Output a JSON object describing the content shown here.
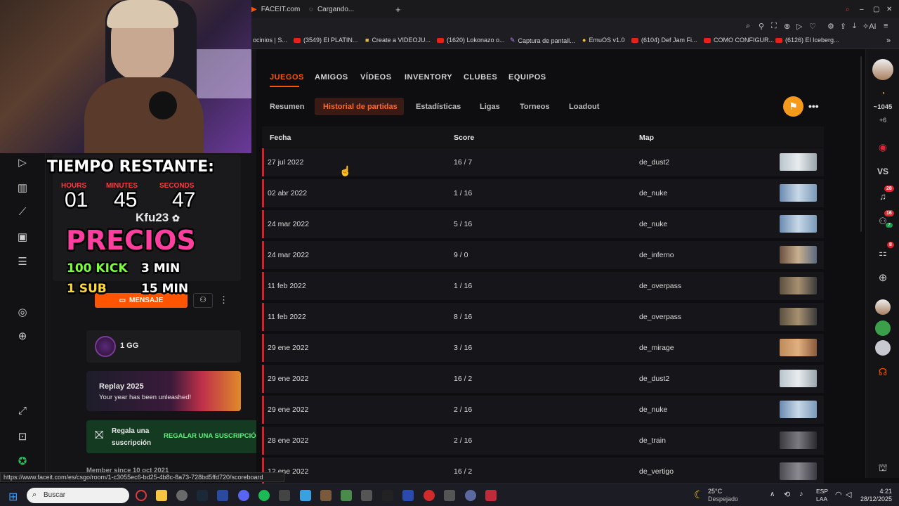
{
  "browser": {
    "tabs": [
      {
        "label": "FACEIT.com"
      },
      {
        "label": "Cargando..."
      }
    ],
    "new_tab": "+",
    "bookmarks": [
      {
        "label": "ocinios | S..."
      },
      {
        "label": "(3549) El PLATIN..."
      },
      {
        "label": "Create a VIDEOJU..."
      },
      {
        "label": "(1620) Lokonazo o..."
      },
      {
        "label": "Captura de pantall..."
      },
      {
        "label": "EmuOS v1.0"
      },
      {
        "label": "(6104) Def Jam Fi..."
      },
      {
        "label": "COMO CONFIGUR..."
      },
      {
        "label": "(6126) El Iceberg..."
      }
    ],
    "ai_label": "AI"
  },
  "overlay": {
    "timer_title": "TIEMPO RESTANTE:",
    "hours_label": "HOURS",
    "minutes_label": "MINUTES",
    "seconds_label": "SECONDS",
    "hours": "01",
    "minutes": "45",
    "seconds": "47",
    "precios": "PRECIOS",
    "price1_amount": "100 KICK",
    "price1_time": "3 MIN",
    "price2_amount": "1 SUB",
    "price2_time": "15 MIN"
  },
  "profile": {
    "username": "Kfu23",
    "message_button": "MENSAJE",
    "gg_label": "1 GG",
    "replay_title": "Replay 2025",
    "replay_subtitle": "Your year has been unleashed!",
    "gift_title": "Regala una suscripción",
    "gift_button": "REGALAR UNA SUSCRIPCIÓN",
    "member_since": "Member since 10 oct 2021"
  },
  "nav": {
    "primary": [
      {
        "label": "JUEGOS",
        "active": true
      },
      {
        "label": "AMIGOS"
      },
      {
        "label": "VÍDEOS"
      },
      {
        "label": "INVENTORY"
      },
      {
        "label": "CLUBES"
      },
      {
        "label": "EQUIPOS"
      }
    ],
    "secondary": [
      {
        "label": "Resumen"
      },
      {
        "label": "Historial de partidas",
        "active": true
      },
      {
        "label": "Estadísticas"
      },
      {
        "label": "Ligas"
      },
      {
        "label": "Torneos"
      },
      {
        "label": "Loadout"
      }
    ]
  },
  "table": {
    "headers": [
      "Fecha",
      "Score",
      "Map"
    ],
    "rows": [
      {
        "date": "27 jul 2022",
        "score": "16 / 7",
        "map": "de_dust2"
      },
      {
        "date": "02 abr 2022",
        "score": "1 / 16",
        "map": "de_nuke"
      },
      {
        "date": "24 mar 2022",
        "score": "5 / 16",
        "map": "de_nuke"
      },
      {
        "date": "24 mar 2022",
        "score": "9 / 0",
        "map": "de_inferno"
      },
      {
        "date": "11 feb 2022",
        "score": "1 / 16",
        "map": "de_overpass"
      },
      {
        "date": "11 feb 2022",
        "score": "8 / 16",
        "map": "de_overpass"
      },
      {
        "date": "29 ene 2022",
        "score": "3 / 16",
        "map": "de_mirage"
      },
      {
        "date": "29 ene 2022",
        "score": "16 / 2",
        "map": "de_dust2"
      },
      {
        "date": "29 ene 2022",
        "score": "2 / 16",
        "map": "de_nuke"
      },
      {
        "date": "28 ene 2022",
        "score": "2 / 16",
        "map": "de_train"
      },
      {
        "date": "12 ene 2022",
        "score": "16 / 2",
        "map": "de_vertigo"
      }
    ]
  },
  "right_rail": {
    "points": "1045",
    "plus": "+6",
    "vs": "VS",
    "notif_badge": "28",
    "friends_badge": "16",
    "friends_online": "7",
    "party_badge": "8"
  },
  "status_url": "https://www.faceit.com/es/csgo/room/1-c3055ec6-bd25-4b8c-8a73-728bd5ffd720/scoreboard",
  "taskbar": {
    "search_placeholder": "Buscar",
    "weather_temp": "25°C",
    "weather_desc": "Despejado",
    "lang": "ESP",
    "lang_sub": "LAA",
    "time": "4:21",
    "date": "28/12/2025"
  },
  "colors": {
    "accent": "#ff5500",
    "row_marker": "#d81e2a",
    "overlay_pink": "#ff3fa0",
    "overlay_green": "#7cff3a"
  }
}
